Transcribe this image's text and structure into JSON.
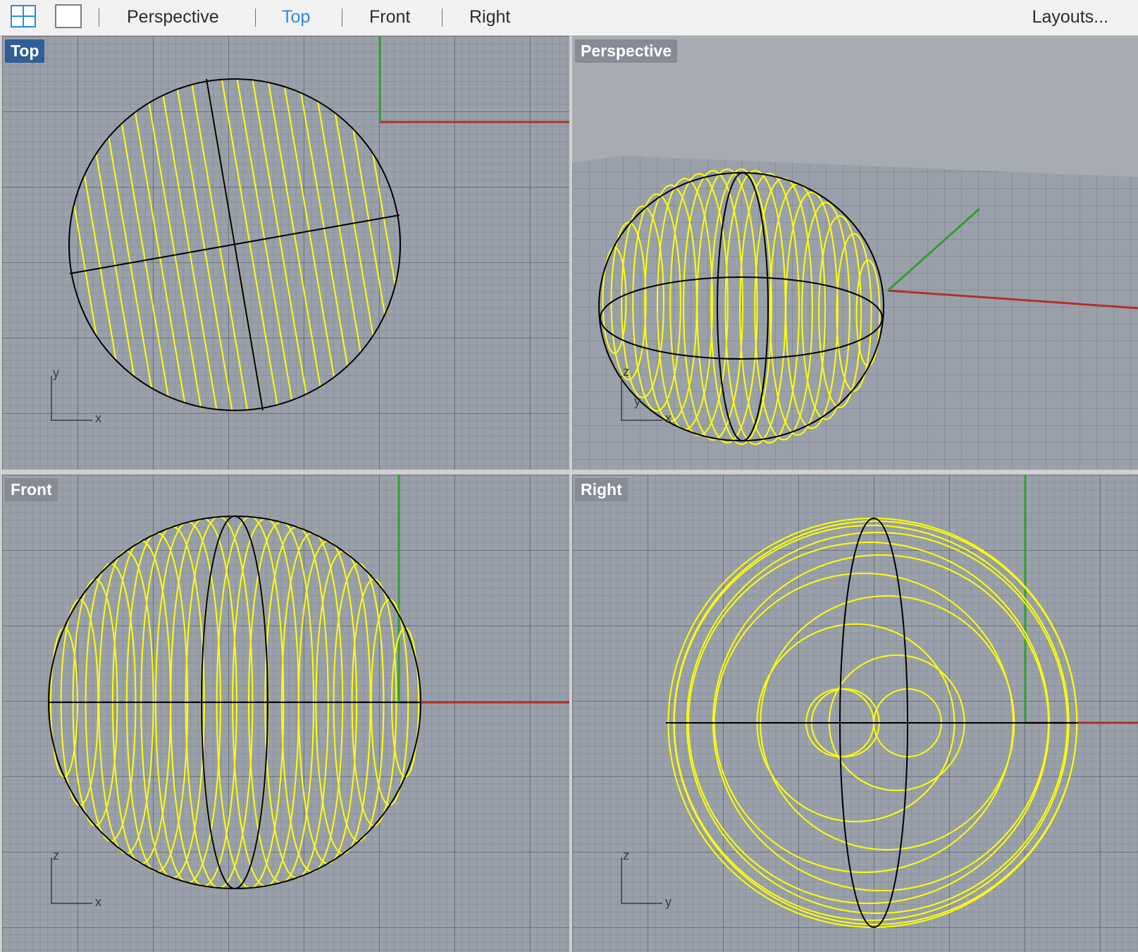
{
  "toolbar": {
    "tabs": [
      "Perspective",
      "Top",
      "Front",
      "Right"
    ],
    "active_tab": "Top",
    "layouts_label": "Layouts..."
  },
  "viewports": {
    "top": {
      "label": "Top",
      "axis_labels": [
        "y",
        "x"
      ]
    },
    "perspective": {
      "label": "Perspective",
      "axis_labels": [
        "z",
        "y",
        "x"
      ]
    },
    "front": {
      "label": "Front",
      "axis_labels": [
        "z",
        "x"
      ]
    },
    "right": {
      "label": "Right",
      "axis_labels": [
        "z",
        "y"
      ]
    }
  },
  "colors": {
    "accent": "#2d8ae0",
    "active_label_bg": "#2f5f96",
    "label_bg": "#868b94",
    "viewport_bg": "#9aa0aa",
    "curve": "#ffff00",
    "outline": "#000000",
    "x_axis": "#b03030",
    "y_axis": "#2f9e2f"
  }
}
